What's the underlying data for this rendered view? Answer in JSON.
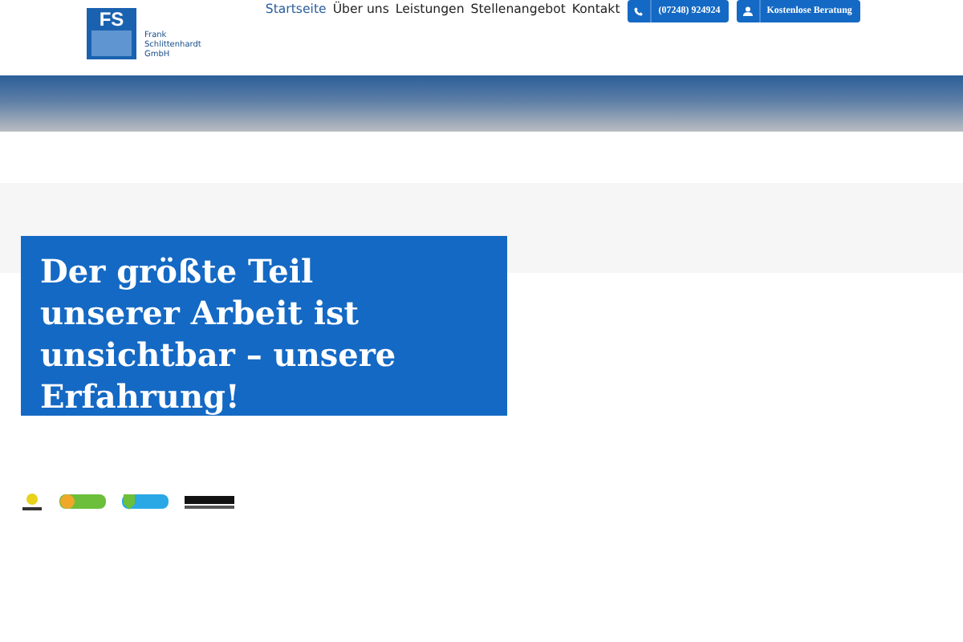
{
  "logo": {
    "mark": "FS",
    "company": [
      "Frank",
      "Schlittenhardt",
      "GmbH"
    ]
  },
  "nav": [
    {
      "label": "Startseite",
      "selected": true
    },
    {
      "label": "Über uns",
      "selected": false
    },
    {
      "label": "Leistungen",
      "selected": false
    },
    {
      "label": "Stellenangebot",
      "selected": false
    },
    {
      "label": "Kontakt",
      "selected": false
    }
  ],
  "buttons": [
    {
      "kind": "phone",
      "label": "(07248) 924924"
    },
    {
      "kind": "person",
      "label": "Kostenlose Beratung"
    }
  ],
  "hero": {
    "headline": "Der größte Teil unserer Arbeit ist unsichtbar – unsere Erfahrung!"
  },
  "badges": [
    {
      "kind": "trusted"
    },
    {
      "kind": "green"
    },
    {
      "kind": "blue"
    },
    {
      "kind": "stars"
    }
  ]
}
